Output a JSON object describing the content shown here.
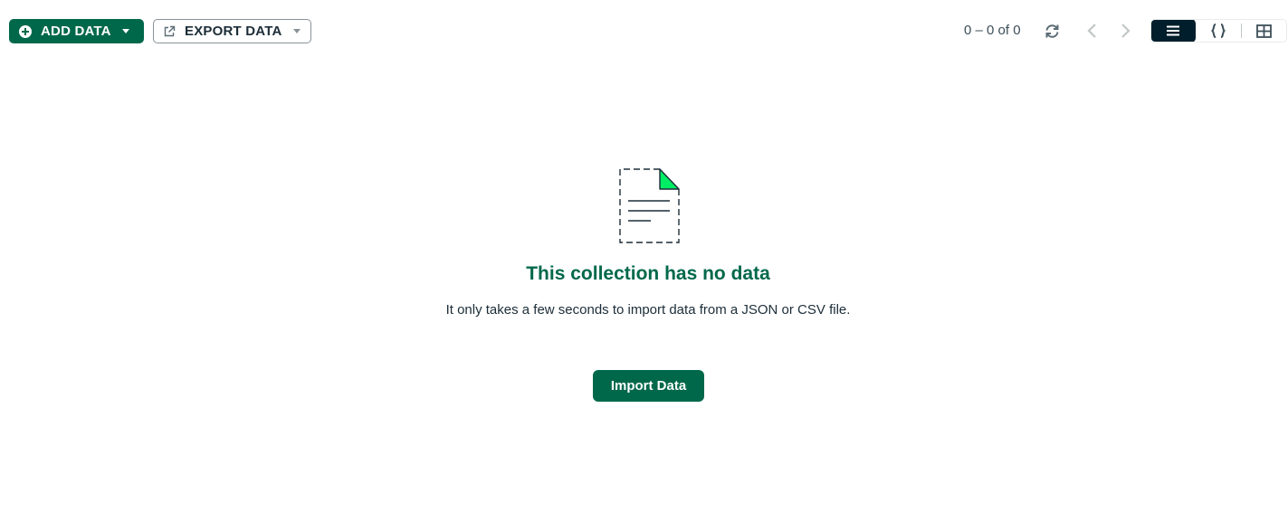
{
  "toolbar": {
    "add_data_label": "ADD DATA",
    "export_data_label": "EXPORT DATA",
    "pagination_text": "0 – 0 of 0",
    "accent_color": "#00684a",
    "icons": {
      "add": "plus-circle-icon",
      "export": "external-link-icon",
      "refresh": "refresh-icon",
      "prev": "chevron-left-icon",
      "next": "chevron-right-icon",
      "list_view": "list-view-icon",
      "json_view": "curly-braces-icon",
      "table_view": "table-view-icon"
    }
  },
  "empty_state": {
    "title": "This collection has no data",
    "description": "It only takes a few seconds to import data from a JSON or CSV file.",
    "import_button_label": "Import Data",
    "icon": "empty-document-icon"
  }
}
